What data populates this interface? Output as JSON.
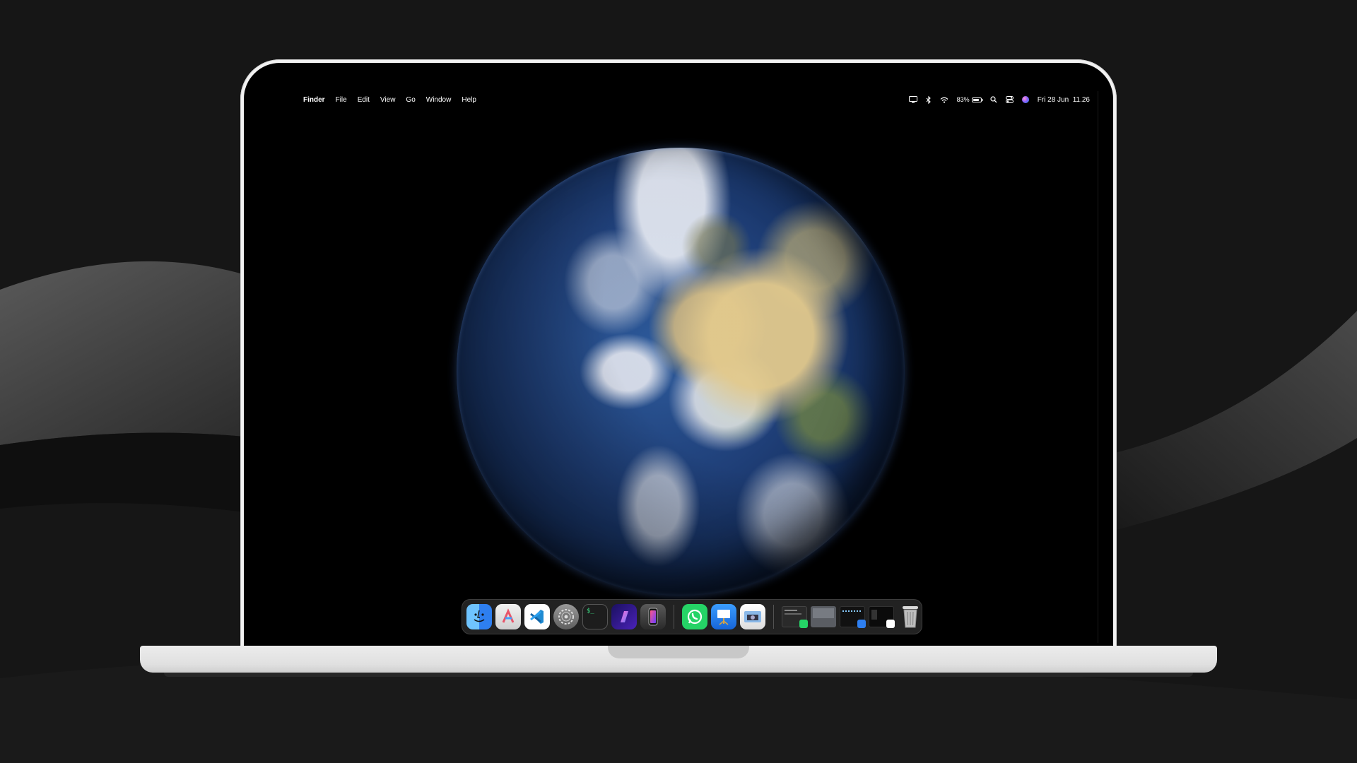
{
  "menubar": {
    "apple_glyph": "",
    "app_name": "Finder",
    "menus": [
      "File",
      "Edit",
      "View",
      "Go",
      "Window",
      "Help"
    ],
    "status": {
      "battery_percent": "83%",
      "battery_level": 0.83,
      "datetime": "Fri 28 Jun  11.26"
    },
    "status_icons": [
      "display-icon",
      "bluetooth-icon",
      "wifi-icon",
      "battery-icon",
      "search-icon",
      "control-center-icon",
      "siri-icon"
    ]
  },
  "wallpaper": {
    "subject": "earth-globe"
  },
  "dock": {
    "apps": [
      {
        "icon": "finder-icon",
        "running": true
      },
      {
        "icon": "launchpad-icon",
        "running": true
      },
      {
        "icon": "vscode-icon",
        "running": true
      },
      {
        "icon": "system-settings-icon",
        "running": false
      },
      {
        "icon": "terminal-icon",
        "running": true
      },
      {
        "icon": "notchnook-icon",
        "running": false
      },
      {
        "icon": "iphone-mirroring-icon",
        "running": false
      },
      {
        "icon": "whatsapp-icon",
        "running": true
      },
      {
        "icon": "keynote-icon",
        "running": false
      },
      {
        "icon": "preview-icon",
        "running": false
      }
    ],
    "windows": [
      {
        "icon": "whatsapp-window-thumbnail"
      },
      {
        "icon": "terminal-window-thumbnail"
      },
      {
        "icon": "finder-window-thumbnail"
      },
      {
        "icon": "vscode-window-thumbnail"
      }
    ],
    "trash": {
      "icon": "trash-icon"
    },
    "terminal_glyph": "$_"
  },
  "colors": {
    "background": "#141414",
    "laptop_silver": "#f2f2f2",
    "screen": "#000000",
    "dock_bg": "rgba(40,40,40,0.85)"
  }
}
